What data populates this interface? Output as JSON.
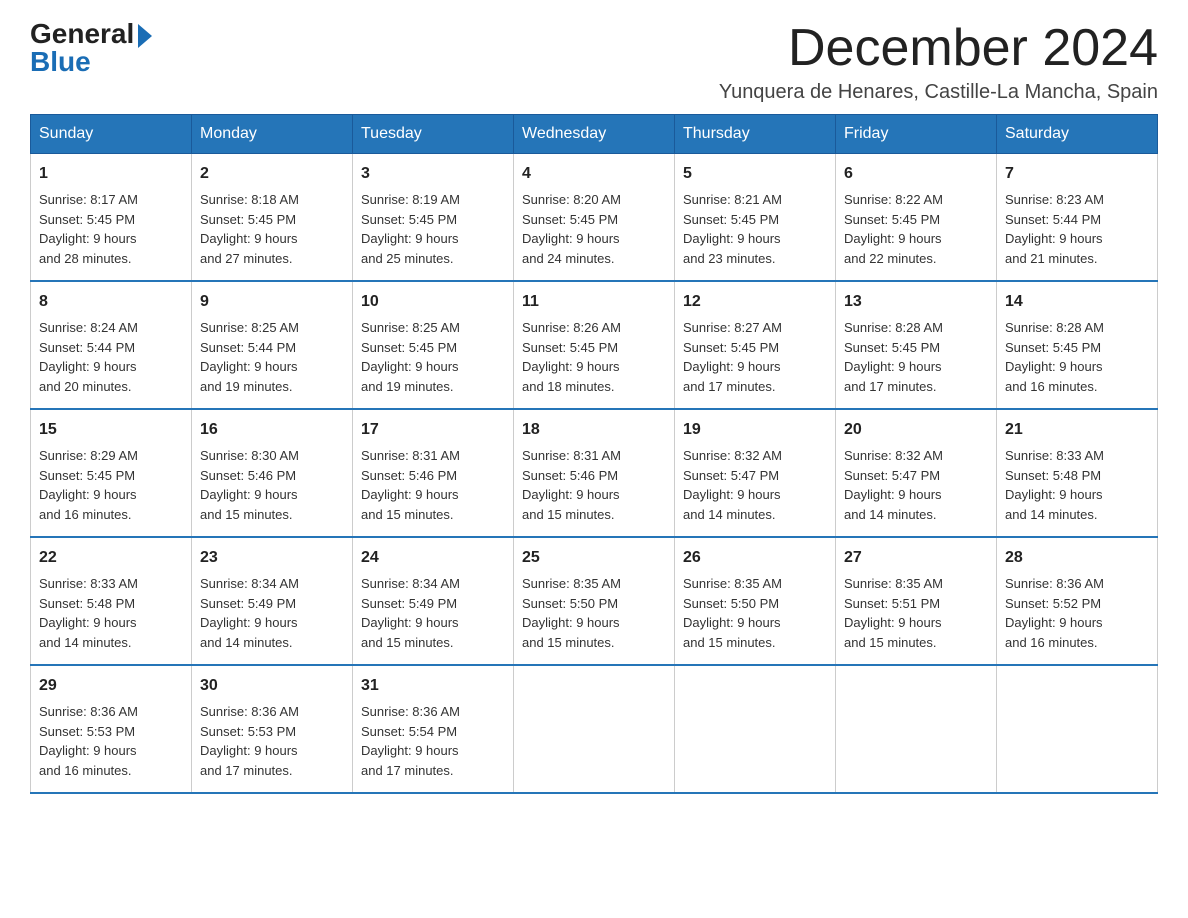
{
  "header": {
    "logo_line1": "General",
    "logo_line2": "Blue",
    "month_title": "December 2024",
    "location": "Yunquera de Henares, Castille-La Mancha, Spain"
  },
  "weekdays": [
    "Sunday",
    "Monday",
    "Tuesday",
    "Wednesday",
    "Thursday",
    "Friday",
    "Saturday"
  ],
  "weeks": [
    [
      {
        "day": "1",
        "sunrise": "8:17 AM",
        "sunset": "5:45 PM",
        "daylight": "9 hours and 28 minutes."
      },
      {
        "day": "2",
        "sunrise": "8:18 AM",
        "sunset": "5:45 PM",
        "daylight": "9 hours and 27 minutes."
      },
      {
        "day": "3",
        "sunrise": "8:19 AM",
        "sunset": "5:45 PM",
        "daylight": "9 hours and 25 minutes."
      },
      {
        "day": "4",
        "sunrise": "8:20 AM",
        "sunset": "5:45 PM",
        "daylight": "9 hours and 24 minutes."
      },
      {
        "day": "5",
        "sunrise": "8:21 AM",
        "sunset": "5:45 PM",
        "daylight": "9 hours and 23 minutes."
      },
      {
        "day": "6",
        "sunrise": "8:22 AM",
        "sunset": "5:45 PM",
        "daylight": "9 hours and 22 minutes."
      },
      {
        "day": "7",
        "sunrise": "8:23 AM",
        "sunset": "5:44 PM",
        "daylight": "9 hours and 21 minutes."
      }
    ],
    [
      {
        "day": "8",
        "sunrise": "8:24 AM",
        "sunset": "5:44 PM",
        "daylight": "9 hours and 20 minutes."
      },
      {
        "day": "9",
        "sunrise": "8:25 AM",
        "sunset": "5:44 PM",
        "daylight": "9 hours and 19 minutes."
      },
      {
        "day": "10",
        "sunrise": "8:25 AM",
        "sunset": "5:45 PM",
        "daylight": "9 hours and 19 minutes."
      },
      {
        "day": "11",
        "sunrise": "8:26 AM",
        "sunset": "5:45 PM",
        "daylight": "9 hours and 18 minutes."
      },
      {
        "day": "12",
        "sunrise": "8:27 AM",
        "sunset": "5:45 PM",
        "daylight": "9 hours and 17 minutes."
      },
      {
        "day": "13",
        "sunrise": "8:28 AM",
        "sunset": "5:45 PM",
        "daylight": "9 hours and 17 minutes."
      },
      {
        "day": "14",
        "sunrise": "8:28 AM",
        "sunset": "5:45 PM",
        "daylight": "9 hours and 16 minutes."
      }
    ],
    [
      {
        "day": "15",
        "sunrise": "8:29 AM",
        "sunset": "5:45 PM",
        "daylight": "9 hours and 16 minutes."
      },
      {
        "day": "16",
        "sunrise": "8:30 AM",
        "sunset": "5:46 PM",
        "daylight": "9 hours and 15 minutes."
      },
      {
        "day": "17",
        "sunrise": "8:31 AM",
        "sunset": "5:46 PM",
        "daylight": "9 hours and 15 minutes."
      },
      {
        "day": "18",
        "sunrise": "8:31 AM",
        "sunset": "5:46 PM",
        "daylight": "9 hours and 15 minutes."
      },
      {
        "day": "19",
        "sunrise": "8:32 AM",
        "sunset": "5:47 PM",
        "daylight": "9 hours and 14 minutes."
      },
      {
        "day": "20",
        "sunrise": "8:32 AM",
        "sunset": "5:47 PM",
        "daylight": "9 hours and 14 minutes."
      },
      {
        "day": "21",
        "sunrise": "8:33 AM",
        "sunset": "5:48 PM",
        "daylight": "9 hours and 14 minutes."
      }
    ],
    [
      {
        "day": "22",
        "sunrise": "8:33 AM",
        "sunset": "5:48 PM",
        "daylight": "9 hours and 14 minutes."
      },
      {
        "day": "23",
        "sunrise": "8:34 AM",
        "sunset": "5:49 PM",
        "daylight": "9 hours and 14 minutes."
      },
      {
        "day": "24",
        "sunrise": "8:34 AM",
        "sunset": "5:49 PM",
        "daylight": "9 hours and 15 minutes."
      },
      {
        "day": "25",
        "sunrise": "8:35 AM",
        "sunset": "5:50 PM",
        "daylight": "9 hours and 15 minutes."
      },
      {
        "day": "26",
        "sunrise": "8:35 AM",
        "sunset": "5:50 PM",
        "daylight": "9 hours and 15 minutes."
      },
      {
        "day": "27",
        "sunrise": "8:35 AM",
        "sunset": "5:51 PM",
        "daylight": "9 hours and 15 minutes."
      },
      {
        "day": "28",
        "sunrise": "8:36 AM",
        "sunset": "5:52 PM",
        "daylight": "9 hours and 16 minutes."
      }
    ],
    [
      {
        "day": "29",
        "sunrise": "8:36 AM",
        "sunset": "5:53 PM",
        "daylight": "9 hours and 16 minutes."
      },
      {
        "day": "30",
        "sunrise": "8:36 AM",
        "sunset": "5:53 PM",
        "daylight": "9 hours and 17 minutes."
      },
      {
        "day": "31",
        "sunrise": "8:36 AM",
        "sunset": "5:54 PM",
        "daylight": "9 hours and 17 minutes."
      },
      null,
      null,
      null,
      null
    ]
  ],
  "labels": {
    "sunrise": "Sunrise:",
    "sunset": "Sunset:",
    "daylight": "Daylight:"
  }
}
